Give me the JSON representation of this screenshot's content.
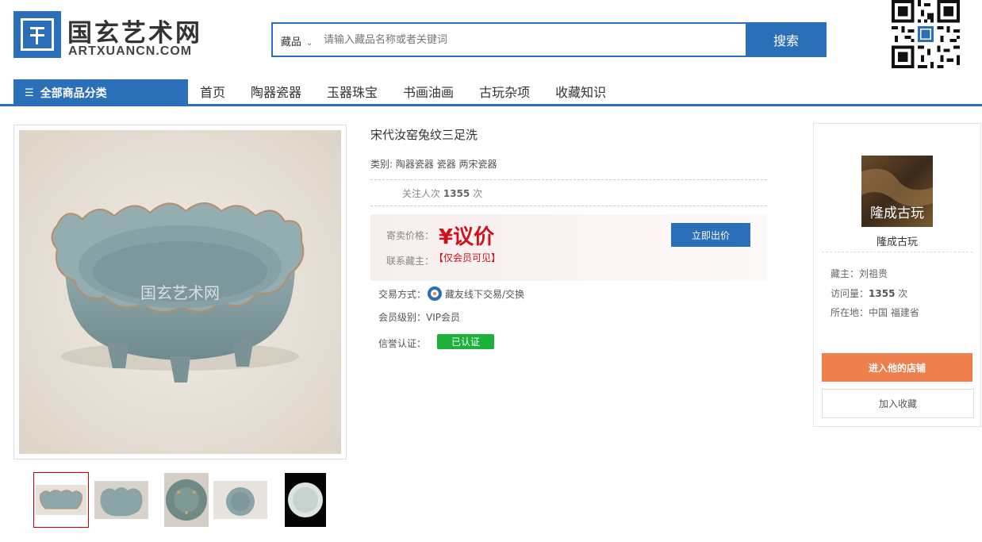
{
  "header": {
    "logo_cn": "国玄艺术网",
    "logo_en": "ARTXUANCN.COM",
    "search_category": "藏品",
    "search_placeholder": "请输入藏品名称或者关键词",
    "search_button": "搜索"
  },
  "nav": {
    "all_categories": "全部商品分类",
    "items": [
      "首页",
      "陶器瓷器",
      "玉器珠宝",
      "书画油画",
      "古玩杂项",
      "收藏知识"
    ]
  },
  "product": {
    "title": "宋代汝窑兔纹三足洗",
    "category_label": "类别:",
    "category_value": "陶器瓷器 瓷器 两宋瓷器",
    "follow_label": "关注人次",
    "follow_count": "1355",
    "follow_unit": "次",
    "price_label": "寄卖价格：",
    "price_value": "¥议价",
    "contact_label": "联系藏主：",
    "contact_value": "【仅会员可见】",
    "bid_button": "立即出价",
    "trade_label": "交易方式：",
    "trade_value": "藏友线下交易/交换",
    "member_label": "会员级别：",
    "member_value": "VIP会员",
    "credit_label": "信誉认证：",
    "credit_value": "已认证",
    "watermark": "国玄艺术网"
  },
  "shop": {
    "avatar_text": "隆成古玩",
    "name": "隆成古玩",
    "owner_label": "藏主：",
    "owner_value": "刘祖贵",
    "visits_label": "访问量：",
    "visits_value": "1355",
    "visits_unit": "次",
    "location_label": "所在地：",
    "location_value": "中国 福建省",
    "enter_button": "进入他的店铺",
    "favorite_button": "加入收藏"
  },
  "colors": {
    "primary": "#2a6fb8",
    "price_red": "#d0101b",
    "verified_green": "#1bb13a",
    "enter_orange": "#ee7f4c"
  }
}
